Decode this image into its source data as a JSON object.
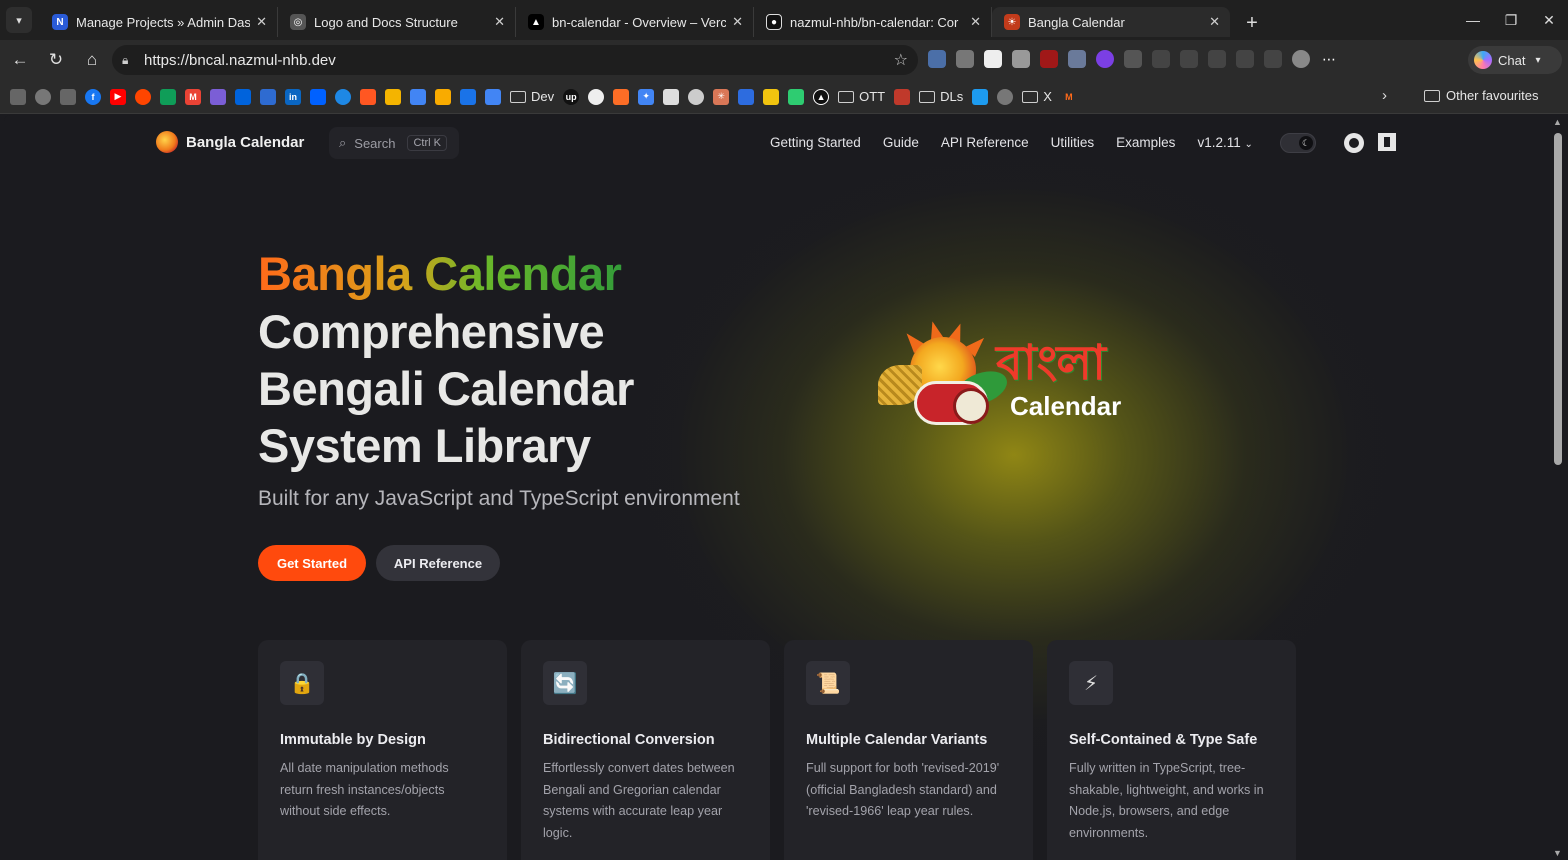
{
  "browser": {
    "tabs": [
      {
        "title": "Manage Projects » Admin Das",
        "favicon": "N",
        "favicon_color": "#2a5bd7"
      },
      {
        "title": "Logo and Docs Structure",
        "favicon": "◎",
        "favicon_color": "#555555"
      },
      {
        "title": "bn-calendar - Overview – Verc",
        "favicon": "▲",
        "favicon_color": "#000000"
      },
      {
        "title": "nazmul-nhb/bn-calendar: Cor",
        "favicon": "●",
        "favicon_color": "#111111"
      },
      {
        "title": "Bangla Calendar",
        "favicon": "☀",
        "favicon_color": "#c23b1b"
      }
    ],
    "url": "https://bncal.nazmul-nhb.dev",
    "chat_label": "Chat",
    "bookmark_folders": [
      "Dev",
      "OTT",
      "DLs",
      "X"
    ],
    "other_favourites": "Other favourites"
  },
  "site": {
    "logo_text": "Bangla Calendar",
    "search_placeholder": "Search",
    "search_shortcut": "Ctrl K",
    "nav": [
      "Getting Started",
      "Guide",
      "API Reference",
      "Utilities",
      "Examples"
    ],
    "version": "v1.2.11"
  },
  "hero": {
    "name": "Bangla Calendar",
    "lines": [
      "Comprehensive",
      "Bengali Calendar",
      "System Library"
    ],
    "tagline": "Built for any JavaScript and TypeScript environment",
    "primary_button": "Get Started",
    "secondary_button": "API Reference",
    "logo_bangla": "বাংলা",
    "logo_calendar": "Calendar"
  },
  "features": [
    {
      "icon": "🔒",
      "title": "Immutable by Design",
      "desc": "All date manipulation methods return fresh instances/objects without side effects."
    },
    {
      "icon": "🔄",
      "title": "Bidirectional Conversion",
      "desc": "Effortlessly convert dates between Bengali and Gregorian calendar systems with accurate leap year logic."
    },
    {
      "icon": "📜",
      "title": "Multiple Calendar Variants",
      "desc": "Full support for both 'revised-2019' (official Bangladesh standard) and 'revised-1966' leap year rules."
    },
    {
      "icon": "⚡",
      "title": "Self-Contained & Type Safe",
      "desc": "Fully written in TypeScript, tree-shakable, lightweight, and works in Node.js, browsers, and edge environments."
    }
  ],
  "colors": {
    "accent": "#ff4a0d",
    "background": "#1b1b1f",
    "card": "#232328"
  }
}
